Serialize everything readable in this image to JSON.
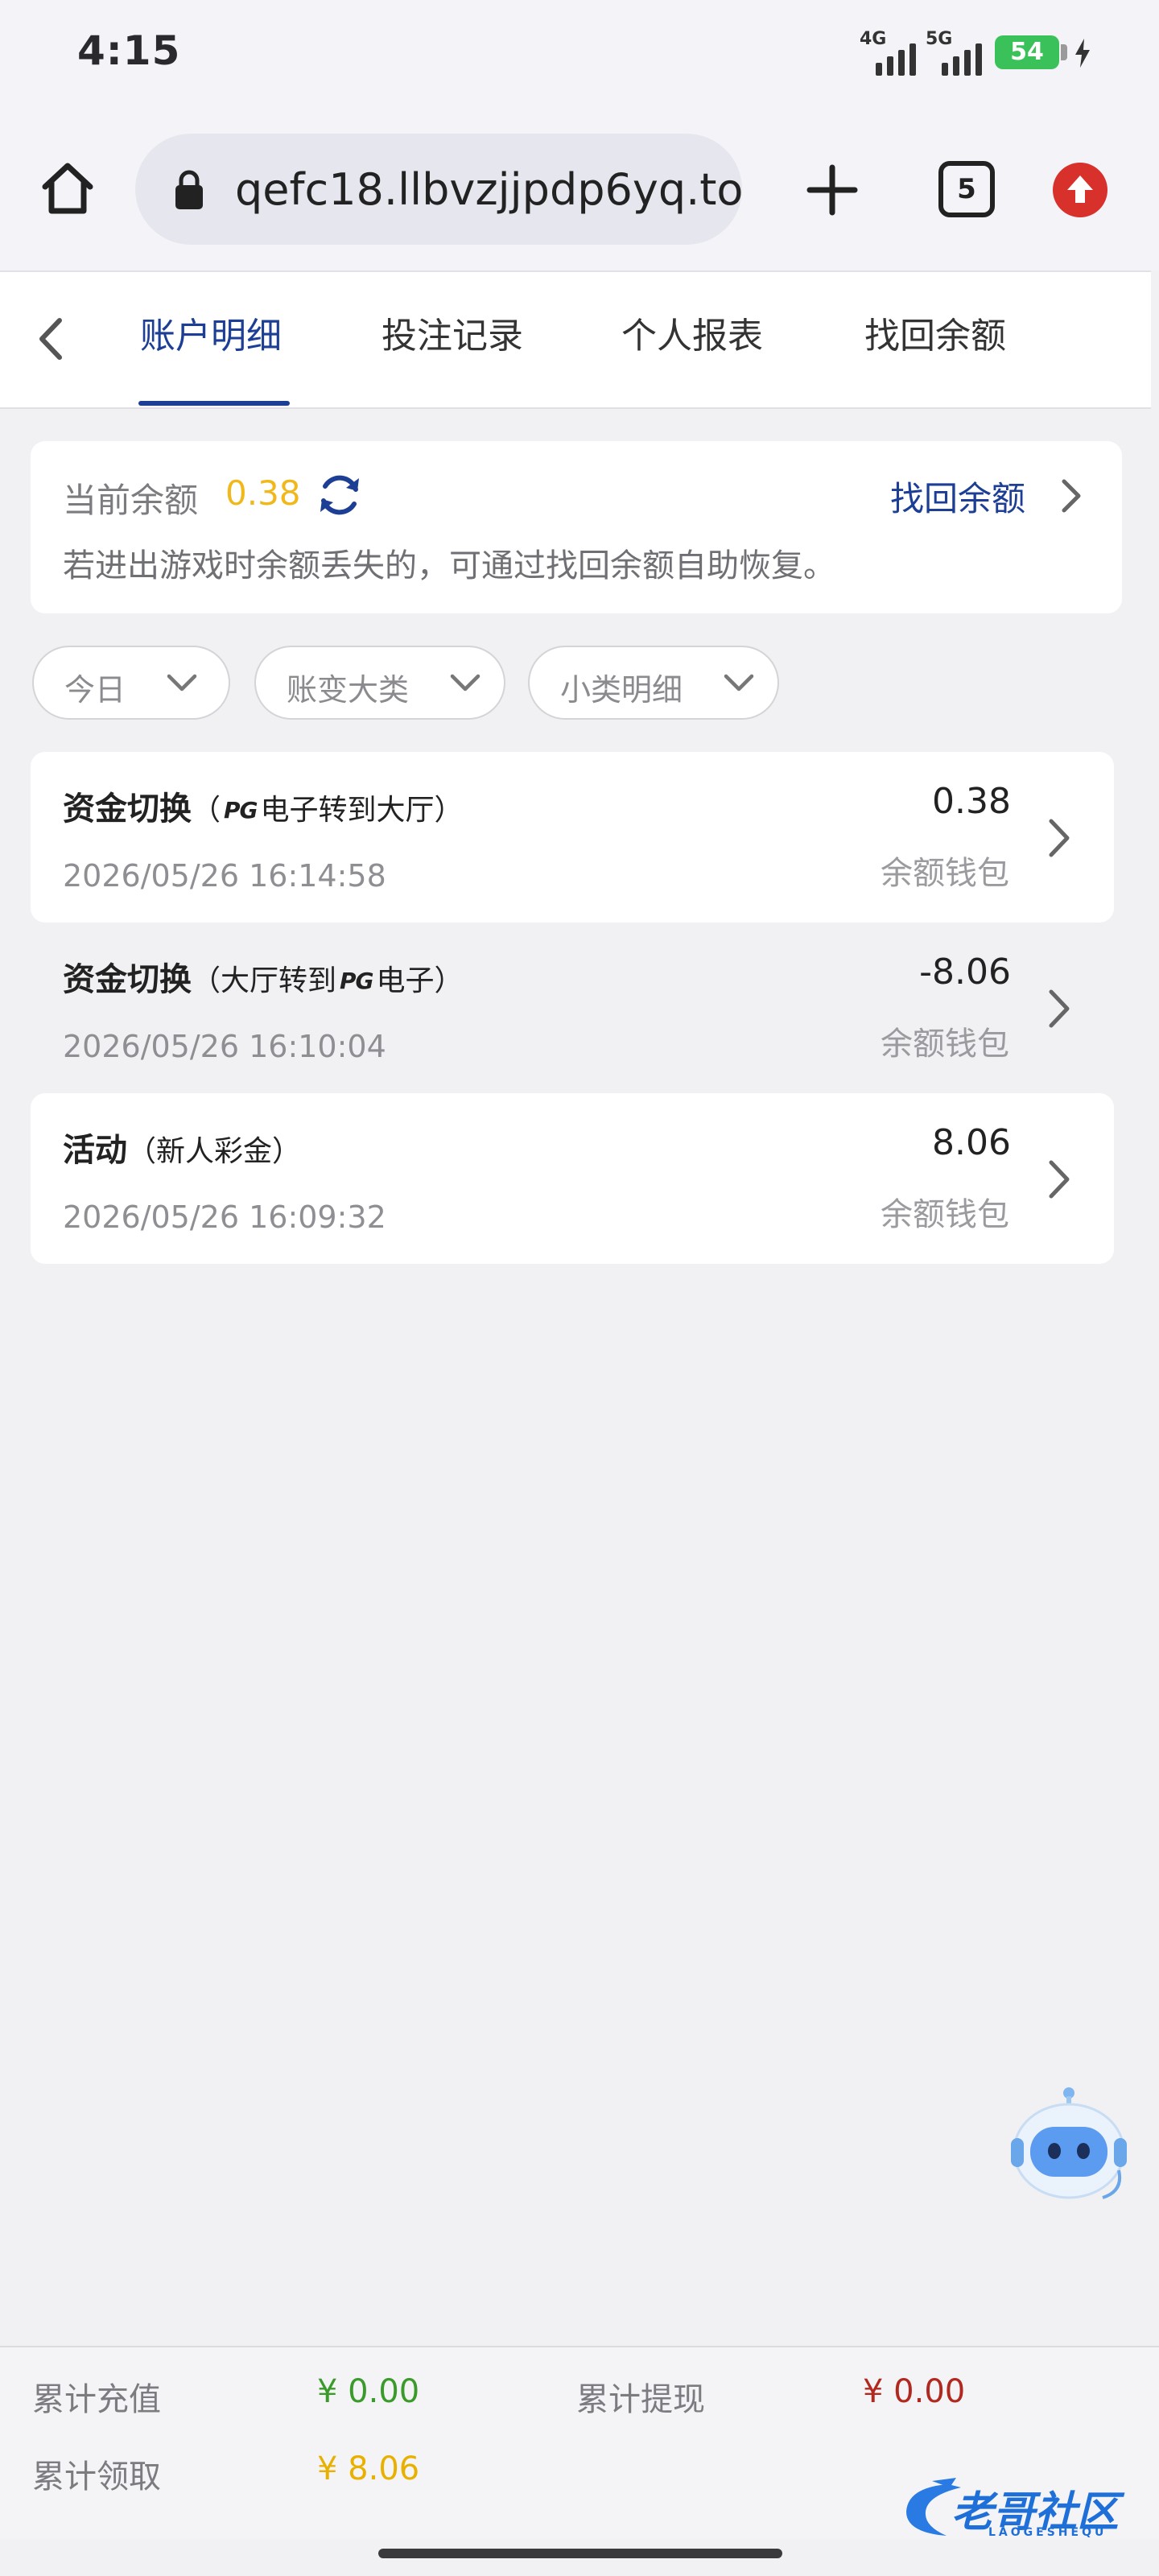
{
  "status_bar": {
    "time": "4:15",
    "net1": "4G",
    "net2": "5G",
    "battery": "54"
  },
  "browser": {
    "url": "qefc18.llbvzjjpdp6yq.top",
    "tab_count": "5"
  },
  "tabs": [
    {
      "label": "账户明细",
      "active": true
    },
    {
      "label": "投注记录",
      "active": false
    },
    {
      "label": "个人报表",
      "active": false
    },
    {
      "label": "找回余额",
      "active": false
    }
  ],
  "balance": {
    "label": "当前余额",
    "value": "0.38",
    "recover_link": "找回余额",
    "hint": "若进出游戏时余额丢失的，可通过找回余额自助恢复。"
  },
  "filters": [
    {
      "label": "今日"
    },
    {
      "label": "账变大类"
    },
    {
      "label": "小类明细"
    }
  ],
  "records": [
    {
      "title": "资金切换",
      "sub_prefix": "（",
      "sub_brand": "PG",
      "sub_rest": "电子转到大厅）",
      "time": "2026/05/26 16:14:58",
      "amount": "0.38",
      "wallet": "余额钱包"
    },
    {
      "title": "资金切换",
      "sub_prefix": "（大厅转到",
      "sub_brand": "PG",
      "sub_rest": "电子）",
      "time": "2026/05/26 16:10:04",
      "amount": "-8.06",
      "wallet": "余额钱包"
    },
    {
      "title": "活动",
      "sub_prefix": "（新人彩金）",
      "sub_brand": "",
      "sub_rest": "",
      "time": "2026/05/26 16:09:32",
      "amount": "8.06",
      "wallet": "余额钱包"
    }
  ],
  "summary": {
    "deposit_label": "累计充值",
    "deposit_value": "¥ 0.00",
    "withdraw_label": "累计提现",
    "withdraw_value": "¥ 0.00",
    "claim_label": "累计领取",
    "claim_value": "¥ 8.06"
  },
  "watermark": {
    "text": "老哥社区",
    "sub": "LAOGESHEQU"
  },
  "colors": {
    "accent": "#1c3f95",
    "gold": "#f0b81a",
    "green": "#3a9a2a",
    "red": "#b0281e"
  }
}
